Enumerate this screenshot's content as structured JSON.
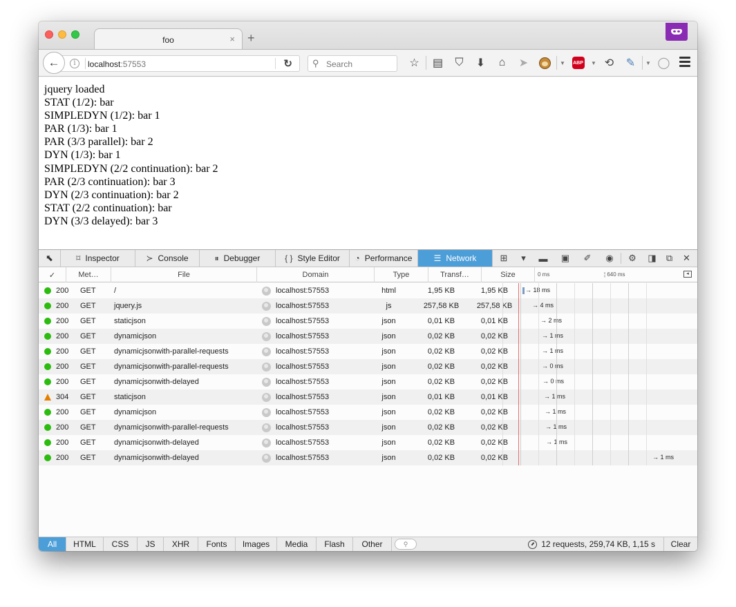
{
  "browser": {
    "tab_title": "foo",
    "tab_close": "×",
    "new_tab": "+",
    "url_host": "localhost",
    "url_port": ":57553",
    "search_placeholder": "Search"
  },
  "page": {
    "lines": [
      "jquery loaded",
      "STAT (1/2): bar",
      "SIMPLEDYN (1/2): bar 1",
      "PAR (1/3): bar 1",
      "PAR (3/3 parallel): bar 2",
      "DYN (1/3): bar 1",
      "SIMPLEDYN (2/2 continuation): bar 2",
      "PAR (2/3 continuation): bar 3",
      "DYN (2/3 continuation): bar 2",
      "STAT (2/2 continuation): bar",
      "DYN (3/3 delayed): bar 3"
    ]
  },
  "devtools": {
    "tabs": [
      {
        "label": "Inspector",
        "icon": "inspector-icon",
        "glyph": "⌑"
      },
      {
        "label": "Console",
        "icon": "console-icon",
        "glyph": "≻"
      },
      {
        "label": "Debugger",
        "icon": "debugger-icon",
        "glyph": "⏸"
      },
      {
        "label": "Style Editor",
        "icon": "style-editor-icon",
        "glyph": "{ }"
      },
      {
        "label": "Performance",
        "icon": "performance-icon",
        "glyph": "◔"
      },
      {
        "label": "Network",
        "icon": "network-icon",
        "glyph": "☰"
      }
    ],
    "active_tab": "Network",
    "columns": {
      "status": "✓",
      "method": "Met…",
      "file": "File",
      "domain": "Domain",
      "type": "Type",
      "transferred": "Transf…",
      "size": "Size"
    },
    "waterfall_ticks": [
      "0 ms",
      "640 ms"
    ],
    "requests": [
      {
        "status": "200",
        "status_kind": "ok",
        "method": "GET",
        "file": "/",
        "domain": "localhost:57553",
        "type": "html",
        "transferred": "1,95 KB",
        "size": "1,95 KB",
        "timing": "→ 18 ms"
      },
      {
        "status": "200",
        "status_kind": "ok",
        "method": "GET",
        "file": "jquery.js",
        "domain": "localhost:57553",
        "type": "js",
        "transferred": "257,58 KB",
        "size": "257,58 KB",
        "timing": "→ 4 ms"
      },
      {
        "status": "200",
        "status_kind": "ok",
        "method": "GET",
        "file": "staticjson",
        "domain": "localhost:57553",
        "type": "json",
        "transferred": "0,01 KB",
        "size": "0,01 KB",
        "timing": "→ 2 ms"
      },
      {
        "status": "200",
        "status_kind": "ok",
        "method": "GET",
        "file": "dynamicjson",
        "domain": "localhost:57553",
        "type": "json",
        "transferred": "0,02 KB",
        "size": "0,02 KB",
        "timing": "→ 1 ms"
      },
      {
        "status": "200",
        "status_kind": "ok",
        "method": "GET",
        "file": "dynamicjsonwith-parallel-requests",
        "domain": "localhost:57553",
        "type": "json",
        "transferred": "0,02 KB",
        "size": "0,02 KB",
        "timing": "→ 1 ms"
      },
      {
        "status": "200",
        "status_kind": "ok",
        "method": "GET",
        "file": "dynamicjsonwith-parallel-requests",
        "domain": "localhost:57553",
        "type": "json",
        "transferred": "0,02 KB",
        "size": "0,02 KB",
        "timing": "→ 0 ms"
      },
      {
        "status": "200",
        "status_kind": "ok",
        "method": "GET",
        "file": "dynamicjsonwith-delayed",
        "domain": "localhost:57553",
        "type": "json",
        "transferred": "0,02 KB",
        "size": "0,02 KB",
        "timing": "→ 0 ms"
      },
      {
        "status": "304",
        "status_kind": "redirect",
        "method": "GET",
        "file": "staticjson",
        "domain": "localhost:57553",
        "type": "json",
        "transferred": "0,01 KB",
        "size": "0,01 KB",
        "timing": "→ 1 ms"
      },
      {
        "status": "200",
        "status_kind": "ok",
        "method": "GET",
        "file": "dynamicjson",
        "domain": "localhost:57553",
        "type": "json",
        "transferred": "0,02 KB",
        "size": "0,02 KB",
        "timing": "→ 1 ms"
      },
      {
        "status": "200",
        "status_kind": "ok",
        "method": "GET",
        "file": "dynamicjsonwith-parallel-requests",
        "domain": "localhost:57553",
        "type": "json",
        "transferred": "0,02 KB",
        "size": "0,02 KB",
        "timing": "→ 1 ms"
      },
      {
        "status": "200",
        "status_kind": "ok",
        "method": "GET",
        "file": "dynamicjsonwith-delayed",
        "domain": "localhost:57553",
        "type": "json",
        "transferred": "0,02 KB",
        "size": "0,02 KB",
        "timing": "→ 1 ms"
      },
      {
        "status": "200",
        "status_kind": "ok",
        "method": "GET",
        "file": "dynamicjsonwith-delayed",
        "domain": "localhost:57553",
        "type": "json",
        "transferred": "0,02 KB",
        "size": "0,02 KB",
        "timing": "→ 1 ms"
      }
    ],
    "filters": [
      "All",
      "HTML",
      "CSS",
      "JS",
      "XHR",
      "Fonts",
      "Images",
      "Media",
      "Flash",
      "Other"
    ],
    "active_filter": "All",
    "summary": "12 requests, 259,74 KB, 1,15 s",
    "clear_label": "Clear"
  },
  "colors": {
    "accent": "#4c9ed9",
    "status_ok": "#2cbb0f",
    "status_304": "#e57e00",
    "private_badge": "#8a2bb3",
    "timeline_marker": "#e36c6c"
  }
}
